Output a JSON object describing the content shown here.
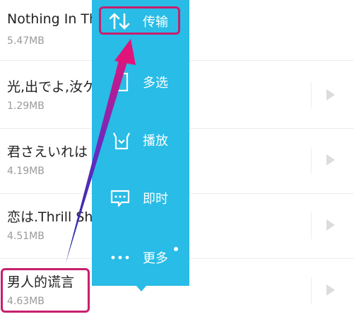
{
  "songs": [
    {
      "title": "Nothing In Th",
      "size": "5.47MB"
    },
    {
      "title": "光,出でよ,汝ケ",
      "size": "1.29MB"
    },
    {
      "title": "君さえいれは",
      "size": "4.19MB"
    },
    {
      "title": "恋は.Thrill Sh",
      "size": "4.51MB"
    },
    {
      "title": "男人的谎言",
      "size": "4.63MB"
    }
  ],
  "menu": {
    "items": [
      {
        "label": "传输",
        "icon": "transfer-icon"
      },
      {
        "label": "多选",
        "icon": "multi-select-icon"
      },
      {
        "label": "播放",
        "icon": "play-mode-icon"
      },
      {
        "label": "即时",
        "icon": "chat-icon"
      },
      {
        "label": "更多",
        "icon": "more-icon"
      }
    ],
    "has_notification_dot": true
  },
  "colors": {
    "menu_background": "#28bce6",
    "highlight_border": "#c6206e",
    "annotation_arrow_top": "#e0147a",
    "annotation_arrow_bottom": "#1d2aa8"
  }
}
